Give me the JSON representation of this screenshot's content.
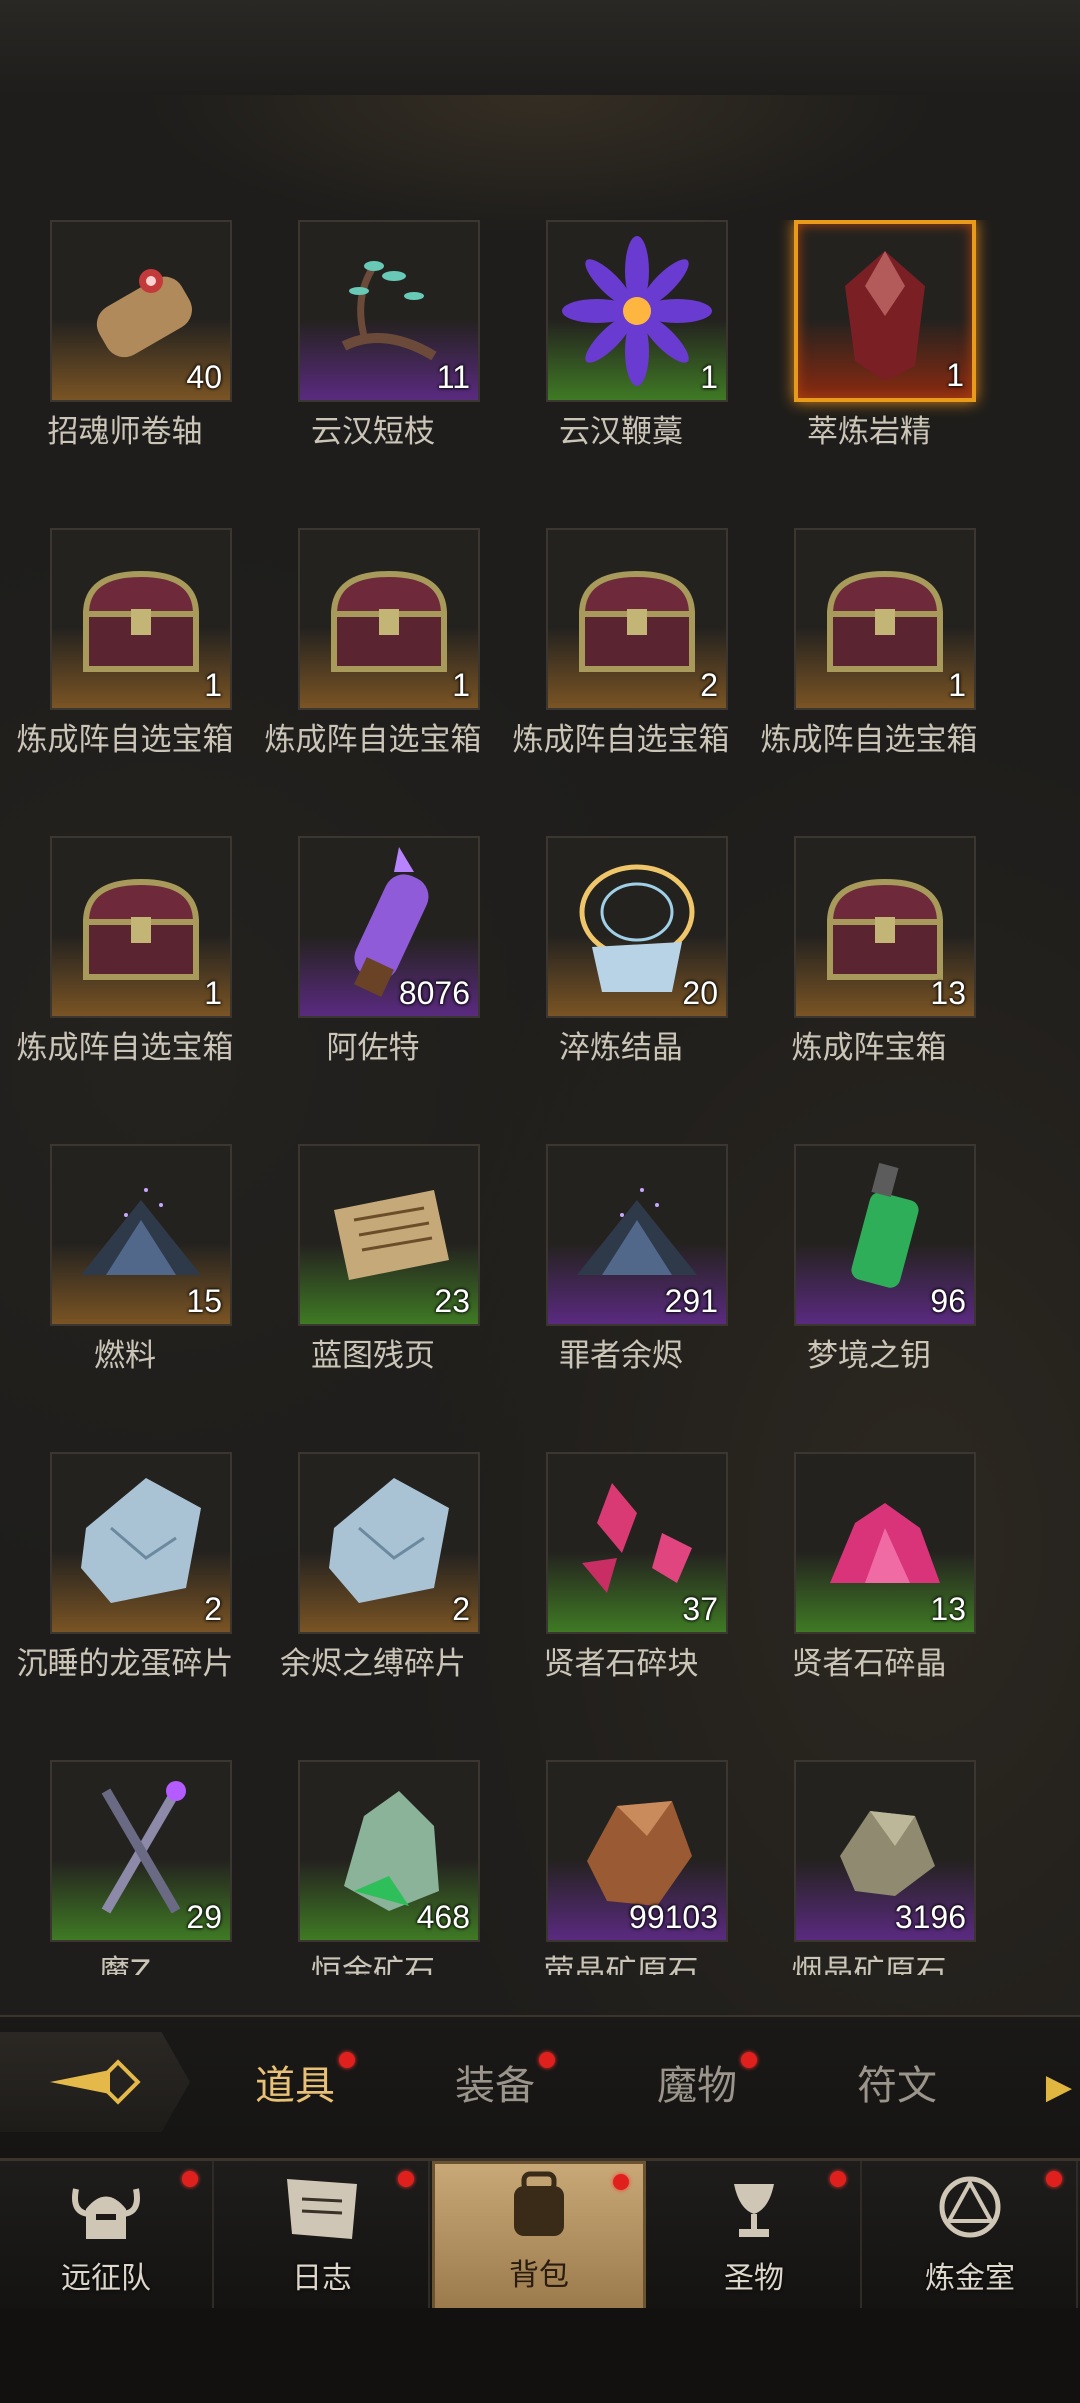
{
  "inventory": {
    "items": [
      {
        "name": "招魂师卷轴",
        "count": "40",
        "quality": "orange",
        "icon": "scroll-icon"
      },
      {
        "name": "云汉短枝",
        "count": "11",
        "quality": "purple",
        "icon": "branch-icon"
      },
      {
        "name": "云汉鞭藁",
        "count": "1",
        "quality": "green",
        "icon": "flower-icon"
      },
      {
        "name": "萃炼岩精",
        "count": "1",
        "quality": "legend",
        "icon": "crystal-icon"
      },
      {
        "name": "炼成阵自选宝箱",
        "count": "1",
        "quality": "orange",
        "icon": "chest-icon"
      },
      {
        "name": "炼成阵自选宝箱",
        "count": "1",
        "quality": "orange",
        "icon": "chest-icon"
      },
      {
        "name": "炼成阵自选宝箱",
        "count": "2",
        "quality": "orange",
        "icon": "chest-icon"
      },
      {
        "name": "炼成阵自选宝箱",
        "count": "1",
        "quality": "orange",
        "icon": "chest-icon"
      },
      {
        "name": "炼成阵自选宝箱",
        "count": "1",
        "quality": "orange",
        "icon": "chest-icon"
      },
      {
        "name": "阿佐特",
        "count": "8076",
        "quality": "purple",
        "icon": "vial-icon"
      },
      {
        "name": "淬炼结晶",
        "count": "20",
        "quality": "orange",
        "icon": "rune-crystal-icon"
      },
      {
        "name": "炼成阵宝箱",
        "count": "13",
        "quality": "orange",
        "icon": "chest-icon"
      },
      {
        "name": "燃料",
        "count": "15",
        "quality": "orange",
        "icon": "ash-pile-icon"
      },
      {
        "name": "蓝图残页",
        "count": "23",
        "quality": "green",
        "icon": "parchment-icon"
      },
      {
        "name": "罪者余烬",
        "count": "291",
        "quality": "purple",
        "icon": "ash-pile-icon"
      },
      {
        "name": "梦境之钥",
        "count": "96",
        "quality": "purple",
        "icon": "lantern-icon"
      },
      {
        "name": "沉睡的龙蛋碎片",
        "count": "2",
        "quality": "orange",
        "icon": "egg-shard-icon"
      },
      {
        "name": "余烬之缚碎片",
        "count": "2",
        "quality": "orange",
        "icon": "egg-shard-icon"
      },
      {
        "name": "贤者石碎块",
        "count": "37",
        "quality": "green",
        "icon": "gem-shards-icon"
      },
      {
        "name": "贤者石碎晶",
        "count": "13",
        "quality": "green",
        "icon": "gem-cluster-icon"
      },
      {
        "name": "魔Z",
        "count": "29",
        "quality": "green",
        "icon": "crossed-blades-icon"
      },
      {
        "name": "恒金矿石",
        "count": "468",
        "quality": "green",
        "icon": "ore-icon"
      },
      {
        "name": "萤晶矿原石",
        "count": "99103",
        "quality": "purple",
        "icon": "amber-ore-icon"
      },
      {
        "name": "烟晶矿原石",
        "count": "3196",
        "quality": "purple",
        "icon": "smoky-ore-icon"
      }
    ]
  },
  "tabs": [
    {
      "label": "道具",
      "active": true
    },
    {
      "label": "装备",
      "active": false
    },
    {
      "label": "魔物",
      "active": false
    },
    {
      "label": "符文",
      "active": false
    }
  ],
  "nav": [
    {
      "label": "远征队",
      "icon": "horned-helmet-icon",
      "active": false
    },
    {
      "label": "日志",
      "icon": "journal-icon",
      "active": false
    },
    {
      "label": "背包",
      "icon": "backpack-icon",
      "active": true
    },
    {
      "label": "圣物",
      "icon": "chalice-icon",
      "active": false
    },
    {
      "label": "炼金室",
      "icon": "alchemy-icon",
      "active": false
    }
  ]
}
